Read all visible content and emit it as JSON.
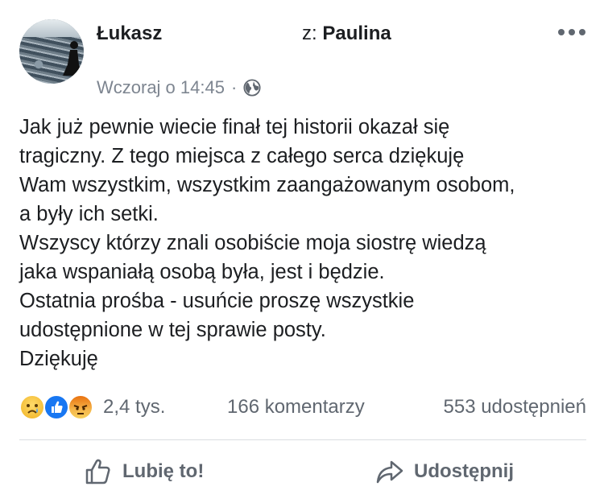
{
  "post": {
    "author": "Łukasz",
    "to_prefix": "z: ",
    "to_name": "Paulina",
    "timestamp": "Wczoraj o 14:45",
    "separator": "·",
    "privacy_icon": "globe-icon",
    "text": "Jak już pewnie wiecie finał tej historii okazał się\ntragiczny. Z tego miejsca z całego serca dziękuję\nWam wszystkim, wszystkim zaangażowanym osobom,\na były ich setki.\nWszyscy którzy znali osobiście moja siostrę wiedzą\njaka wspaniałą osobą była, jest i będzie.\nOstatnia prośba - usuńcie proszę wszystkie\nudostępnione w tej sprawie posty.\nDziękuję"
  },
  "stats": {
    "reaction_icons": [
      "sad-reaction-icon",
      "like-reaction-icon",
      "angry-reaction-icon"
    ],
    "reactions": "2,4 tys.",
    "comments": "166 komentarzy",
    "shares": "553 udostępnień"
  },
  "actions": {
    "like_label": "Lubię to!",
    "share_label": "Udostępnij"
  },
  "colors": {
    "text": "#1c1e21",
    "muted": "#606770",
    "divider": "#dadde1",
    "like_blue": "#1877f2"
  }
}
